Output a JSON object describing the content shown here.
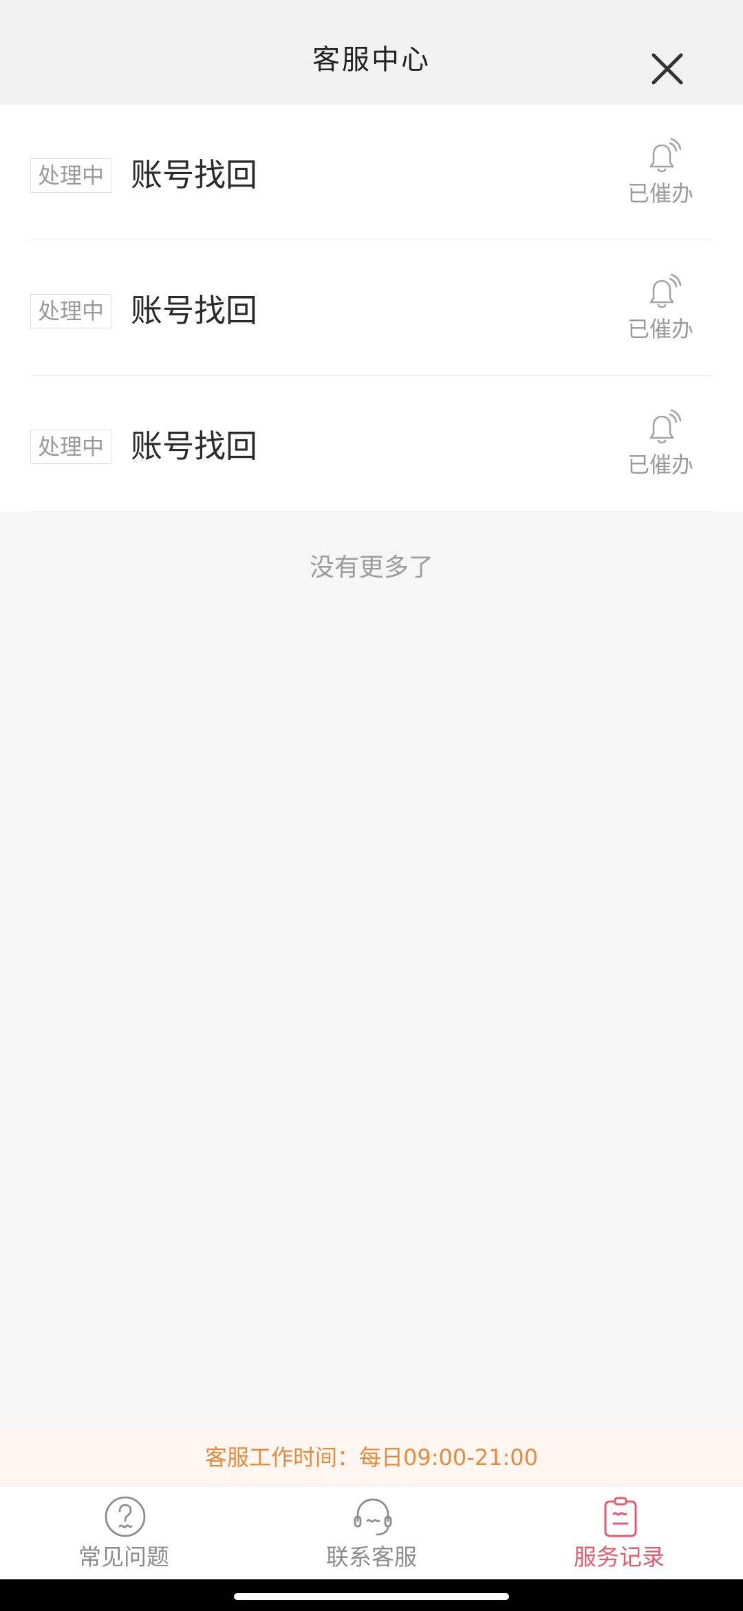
{
  "header": {
    "title": "客服中心"
  },
  "records": [
    {
      "status": "处理中",
      "title": "账号找回",
      "remind_label": "已催办"
    },
    {
      "status": "处理中",
      "title": "账号找回",
      "remind_label": "已催办"
    },
    {
      "status": "处理中",
      "title": "账号找回",
      "remind_label": "已催办"
    }
  ],
  "list_footer": "没有更多了",
  "service_hours": "客服工作时间：每日09:00-21:00",
  "tabs": [
    {
      "label": "常见问题",
      "icon": "question-circle-icon",
      "active": false
    },
    {
      "label": "联系客服",
      "icon": "headset-icon",
      "active": false
    },
    {
      "label": "服务记录",
      "icon": "clipboard-icon",
      "active": true
    }
  ],
  "colors": {
    "accent": "#e65a6e",
    "service_hours_text": "#e98a3a",
    "service_hours_bg": "#fdf6f1",
    "muted_text": "#9a9a9a",
    "page_bg": "#f6f6f6"
  }
}
